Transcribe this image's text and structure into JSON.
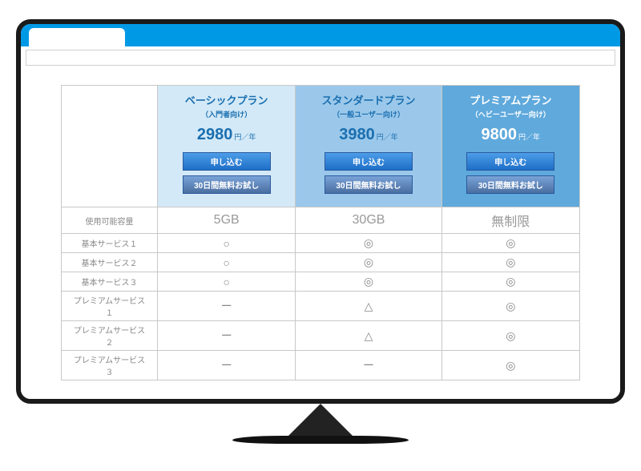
{
  "plans": [
    {
      "name": "ベーシックプラン",
      "sub": "（入門者向け）",
      "price": "2980",
      "unit": "円／年",
      "apply": "申し込む",
      "trial": "30日間無料お試し"
    },
    {
      "name": "スタンダードプラン",
      "sub": "（一般ユーザー向け）",
      "price": "3980",
      "unit": "円／年",
      "apply": "申し込む",
      "trial": "30日間無料お試し"
    },
    {
      "name": "プレミアムプラン",
      "sub": "（ヘビーユーザー向け）",
      "price": "9800",
      "unit": "円／年",
      "apply": "申し込む",
      "trial": "30日間無料お試し"
    }
  ],
  "rows": [
    {
      "label": "使用可能容量",
      "v": [
        "5GB",
        "30GB",
        "無制限"
      ],
      "big": true
    },
    {
      "label": "基本サービス１",
      "v": [
        "○",
        "◎",
        "◎"
      ]
    },
    {
      "label": "基本サービス２",
      "v": [
        "○",
        "◎",
        "◎"
      ]
    },
    {
      "label": "基本サービス３",
      "v": [
        "○",
        "◎",
        "◎"
      ]
    },
    {
      "label": "プレミアムサービス１",
      "v": [
        "ー",
        "△",
        "◎"
      ]
    },
    {
      "label": "プレミアムサービス２",
      "v": [
        "ー",
        "△",
        "◎"
      ]
    },
    {
      "label": "プレミアムサービス３",
      "v": [
        "ー",
        "ー",
        "◎"
      ]
    }
  ]
}
